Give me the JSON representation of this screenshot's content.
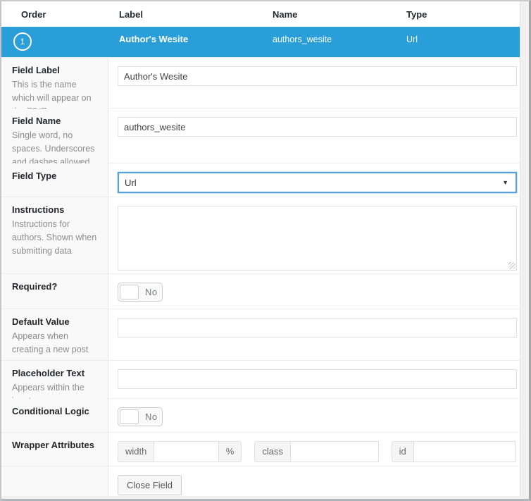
{
  "colors": {
    "accent_blue": "#2a9ed9",
    "focus_blue": "#56a0d9",
    "label_column_bg": "#f9f9f9"
  },
  "table_header": {
    "order": "Order",
    "label": "Label",
    "name": "Name",
    "type": "Type"
  },
  "field_row": {
    "order_number": "1",
    "label": "Author's Wesite",
    "name": "authors_wesite",
    "type": "Url"
  },
  "settings": {
    "field_label": {
      "label": "Field Label",
      "description": "This is the name which will appear on the EDIT page",
      "value": "Author's Wesite"
    },
    "field_name": {
      "label": "Field Name",
      "description": "Single word, no spaces. Underscores and dashes allowed",
      "value": "authors_wesite"
    },
    "field_type": {
      "label": "Field Type",
      "value": "Url"
    },
    "instructions": {
      "label": "Instructions",
      "description": "Instructions for authors. Shown when submitting data",
      "value": ""
    },
    "required": {
      "label": "Required?",
      "toggle_value": "No"
    },
    "default_value": {
      "label": "Default Value",
      "description": "Appears when creating a new post",
      "value": ""
    },
    "placeholder_text": {
      "label": "Placeholder Text",
      "description": "Appears within the input",
      "value": ""
    },
    "conditional_logic": {
      "label": "Conditional Logic",
      "toggle_value": "No"
    },
    "wrapper_attributes": {
      "label": "Wrapper Attributes",
      "width_label": "width",
      "width_suffix": "%",
      "class_label": "class",
      "id_label": "id"
    },
    "close_field": {
      "button_label": "Close Field"
    }
  }
}
